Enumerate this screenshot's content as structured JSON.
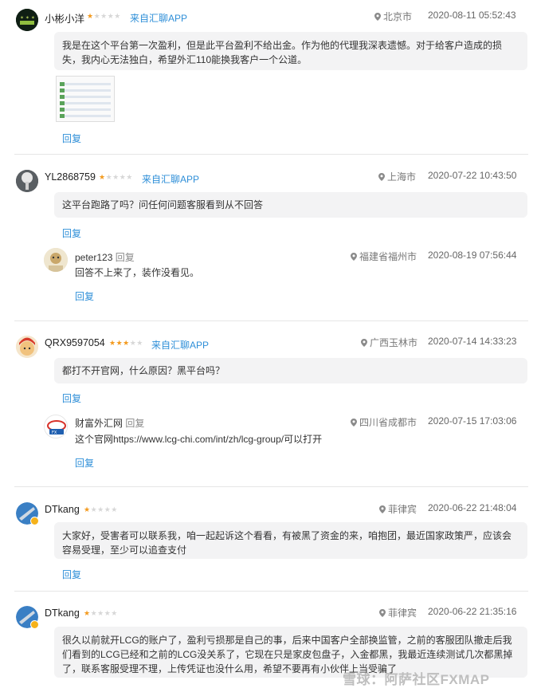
{
  "comments": [
    {
      "user": "小彬小洋",
      "rating": 1,
      "source": "来自汇聊APP",
      "location": "北京市",
      "time": "2020-08-11 05:52:43",
      "text": "我是在这个平台第一次盈利，但是此平台盈利不给出金。作为他的代理我深表遗憾。对于给客户造成的损失，我内心无法独白，希望外汇110能换我客户一个公道。",
      "reply_label": "回复",
      "replies": []
    },
    {
      "user": "YL2868759",
      "rating": 1,
      "source": "来自汇聊APP",
      "location": "上海市",
      "time": "2020-07-22 10:43:50",
      "text": "这平台跑路了吗？问任何问题客服看到从不回答",
      "reply_label": "回复",
      "replies": [
        {
          "user": "peter123",
          "tag": "回复",
          "location": "福建省福州市",
          "time": "2020-08-19 07:56:44",
          "text": "回答不上来了，装作没看见。",
          "reply_label": "回复"
        }
      ]
    },
    {
      "user": "QRX9597054",
      "rating": 3,
      "source": "来自汇聊APP",
      "location": "广西玉林市",
      "time": "2020-07-14 14:33:23",
      "text": "都打不开官网，什么原因？黑平台吗？",
      "reply_label": "回复",
      "replies": [
        {
          "user": "财富外汇网",
          "tag": "回复",
          "location": "四川省成都市",
          "time": "2020-07-15 17:03:06",
          "text": "这个官网https://www.lcg-chi.com/int/zh/lcg-group/可以打开",
          "reply_label": "回复"
        }
      ]
    },
    {
      "user": "DTkang",
      "rating": 1,
      "source": "",
      "location": "菲律宾",
      "time": "2020-06-22 21:48:04",
      "text": "大家好，受害者可以联系我，咱一起起诉这个看看，有被黑了资金的来，咱抱团，最近国家政策严，应该会容易受理，至少可以追查支付",
      "reply_label": "回复",
      "replies": []
    },
    {
      "user": "DTkang",
      "rating": 1,
      "source": "",
      "location": "菲律宾",
      "time": "2020-06-22 21:35:16",
      "text": "很久以前就开LCG的账户了，盈利亏损那是自己的事，后来中国客户全部换监管，之前的客服团队撤走后我们看到的LCG已经和之前的LCG没关系了，它现在只是家皮包盘子，入金都黑，我最近连续测试几次都黑掉了，联系客服受理不理，上传凭证也没什么用，希望不要再有小伙伴上当受骗了",
      "reply_label": "",
      "replies": []
    }
  ],
  "watermark": "雪球：阿萨社区FXMAP",
  "colors": {
    "link": "#2f8fd8",
    "star_on": "#f39a1e",
    "star_off": "#d7d7d7",
    "bubble": "#f3f3f4"
  }
}
